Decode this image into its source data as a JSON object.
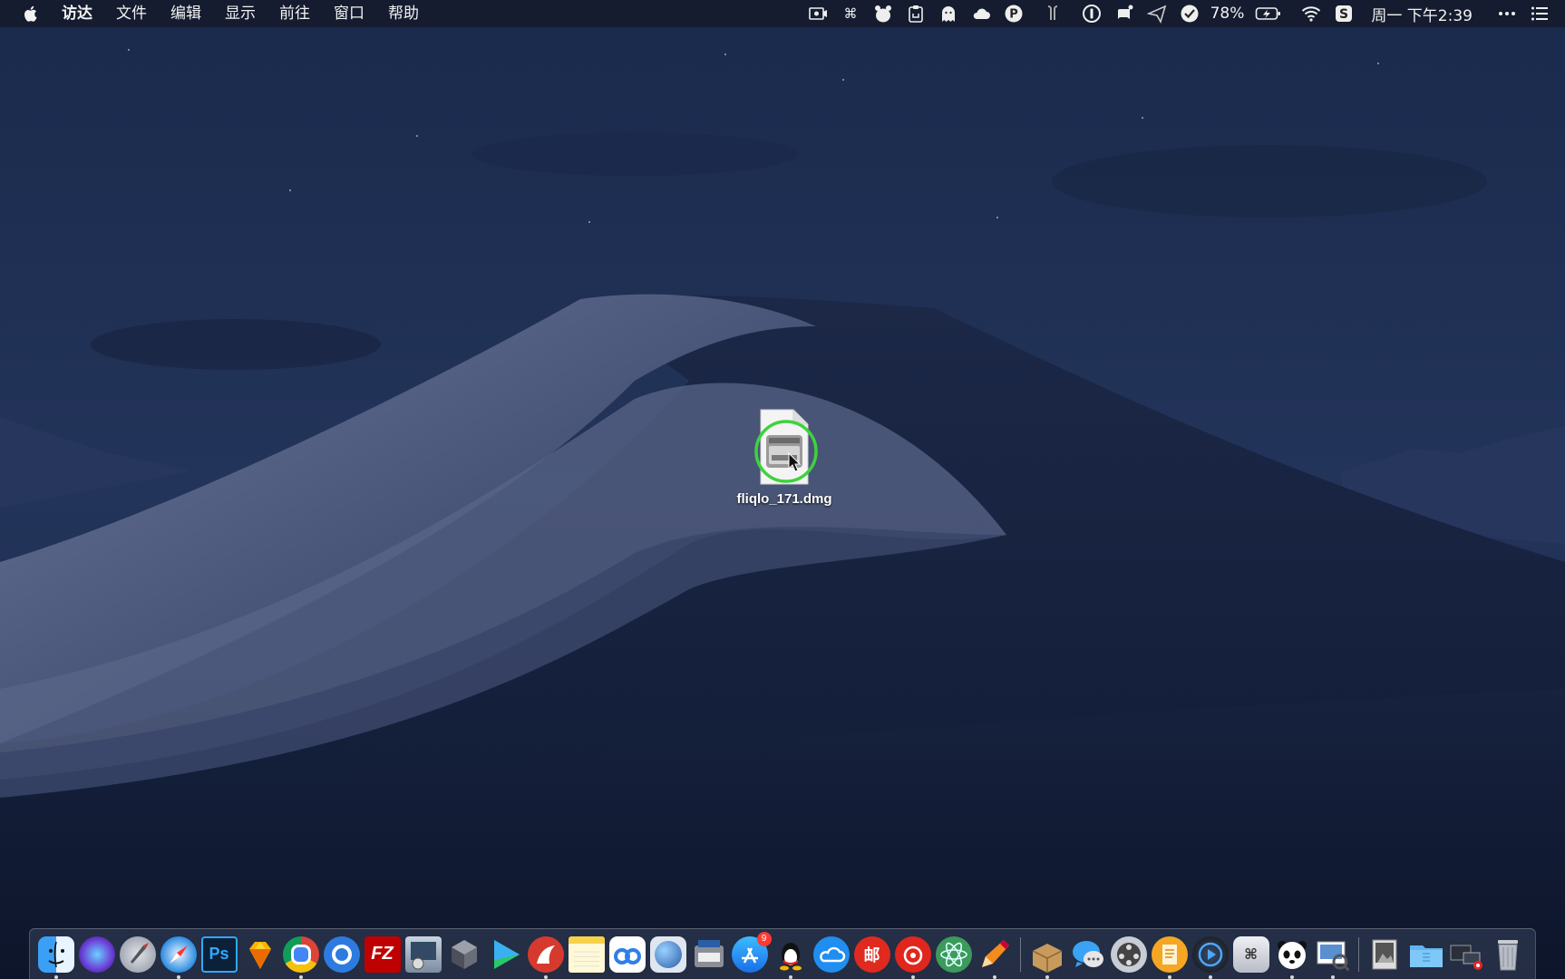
{
  "menubar": {
    "app_name": "访达",
    "items": [
      "文件",
      "编辑",
      "显示",
      "前往",
      "窗口",
      "帮助"
    ],
    "battery": "78%",
    "clock": "周一 下午2:39"
  },
  "status_icons": [
    "screen-record-icon",
    "command-icon",
    "bear-icon",
    "clipboard-icon",
    "ghost-icon",
    "cloud-icon",
    "p-app-icon",
    "airpods-icon",
    "1password-icon",
    "notification-icon",
    "send-icon",
    "check-app-icon",
    "battery-icon",
    "wifi-icon",
    "sogou-icon",
    "more-icon",
    "list-icon"
  ],
  "desktop": {
    "file_name": "fliqlo_171.dmg",
    "cursor_highlight_color": "#3ed23e"
  },
  "dock": {
    "apps": [
      {
        "name": "finder",
        "icon": "finder-icon",
        "running": true
      },
      {
        "name": "siri",
        "icon": "siri-icon",
        "running": false
      },
      {
        "name": "launchpad",
        "icon": "launchpad-icon",
        "running": false
      },
      {
        "name": "safari",
        "icon": "safari-icon",
        "running": true
      },
      {
        "name": "photoshop",
        "icon": "photoshop-icon",
        "label": "Ps",
        "running": false
      },
      {
        "name": "sketch",
        "icon": "sketch-icon",
        "running": false
      },
      {
        "name": "chrome",
        "icon": "chrome-icon",
        "running": true
      },
      {
        "name": "browser",
        "icon": "browser-icon",
        "running": false
      },
      {
        "name": "filezilla",
        "icon": "filezilla-icon",
        "label": "FZ",
        "running": false
      },
      {
        "name": "utility",
        "icon": "utility-icon",
        "running": false
      },
      {
        "name": "virtualbox",
        "icon": "cube-icon",
        "running": false
      },
      {
        "name": "infuse",
        "icon": "play-icon",
        "running": false
      },
      {
        "name": "red-app",
        "icon": "red-app-icon",
        "running": true
      },
      {
        "name": "notes",
        "icon": "notes-icon",
        "running": false
      },
      {
        "name": "baidu-netdisk",
        "icon": "netdisk-icon",
        "running": false
      },
      {
        "name": "network",
        "icon": "globe-icon",
        "running": false
      },
      {
        "name": "scanner",
        "icon": "scanner-icon",
        "running": false
      },
      {
        "name": "app-store",
        "icon": "app-store-icon",
        "badge": "9",
        "running": false
      },
      {
        "name": "qq",
        "icon": "qq-icon",
        "running": true
      },
      {
        "name": "cloud",
        "icon": "cloud-app-icon",
        "running": false
      },
      {
        "name": "mail-app",
        "icon": "mail-red-icon",
        "label": "邮",
        "running": false
      },
      {
        "name": "netease-music",
        "icon": "netease-icon",
        "running": true
      },
      {
        "name": "atom",
        "icon": "atom-icon",
        "running": false
      },
      {
        "name": "pencil-app",
        "icon": "pencil-icon",
        "running": true
      },
      {
        "name": "installer",
        "icon": "installer-icon",
        "running": true
      },
      {
        "name": "messages",
        "icon": "messages-icon",
        "running": false
      },
      {
        "name": "video-converter",
        "icon": "film-icon",
        "running": false
      },
      {
        "name": "pages",
        "icon": "pages-icon",
        "running": true
      },
      {
        "name": "quicktime",
        "icon": "quicktime-icon",
        "running": true
      },
      {
        "name": "keyboard-app",
        "icon": "keyboard-icon",
        "running": false
      },
      {
        "name": "panda",
        "icon": "panda-icon",
        "running": true
      },
      {
        "name": "preview",
        "icon": "preview-icon",
        "running": true
      }
    ],
    "stacks": [
      {
        "name": "photos-stack",
        "icon": "photo-stack-icon"
      },
      {
        "name": "downloads-folder",
        "icon": "folder-icon"
      },
      {
        "name": "screenshot-stack",
        "icon": "screenshot-stack-icon"
      },
      {
        "name": "trash",
        "icon": "trash-icon"
      }
    ]
  }
}
